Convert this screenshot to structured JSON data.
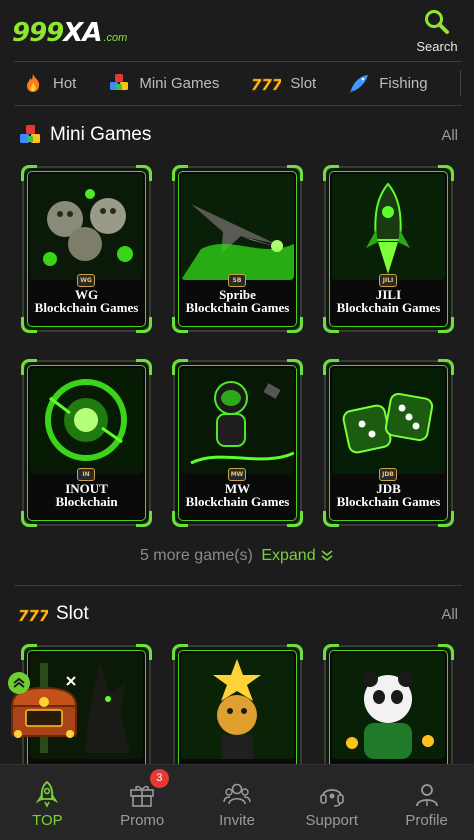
{
  "header": {
    "logo_number": "999",
    "logo_letters": "XA",
    "logo_domain": ".com",
    "search_label": "Search"
  },
  "tabs": [
    {
      "label": "Hot",
      "icon": "fire-icon"
    },
    {
      "label": "Mini Games",
      "icon": "cubes-icon"
    },
    {
      "label": "Slot",
      "icon": "777-icon"
    },
    {
      "label": "Fishing",
      "icon": "fish-icon"
    }
  ],
  "mini_games": {
    "title": "Mini Games",
    "all_label": "All",
    "games": [
      {
        "line1": "WG",
        "line2": "Blockchain Games",
        "badge": "WG",
        "art": "tigers"
      },
      {
        "line1": "Spribe",
        "line2": "Blockchain Games",
        "badge": "SB",
        "art": "jet"
      },
      {
        "line1": "JILI",
        "line2": "Blockchain Games",
        "badge": "JILI",
        "art": "rocket"
      },
      {
        "line1": "INOUT",
        "line2": "Blockchain",
        "badge": "IN",
        "art": "orb"
      },
      {
        "line1": "MW",
        "line2": "Blockchain Games",
        "badge": "MW",
        "art": "astronaut"
      },
      {
        "line1": "JDB",
        "line2": "Blockchain Games",
        "badge": "JDB",
        "art": "dice"
      }
    ],
    "more_count": "5 more game(s)",
    "expand_label": "Expand"
  },
  "slot": {
    "title": "Slot",
    "all_label": "All",
    "games": [
      {
        "art": "anubis"
      },
      {
        "art": "leopard"
      },
      {
        "art": "panda"
      }
    ]
  },
  "bottom_nav": [
    {
      "label": "TOP",
      "icon": "rocket-icon",
      "active": true
    },
    {
      "label": "Promo",
      "icon": "gift-icon",
      "badge": "3"
    },
    {
      "label": "Invite",
      "icon": "users-icon"
    },
    {
      "label": "Support",
      "icon": "headset-icon"
    },
    {
      "label": "Profile",
      "icon": "user-icon"
    }
  ],
  "colors": {
    "accent": "#77d13a",
    "background": "#1c1c1c",
    "nav_background": "#262626",
    "badge": "#e53935"
  }
}
